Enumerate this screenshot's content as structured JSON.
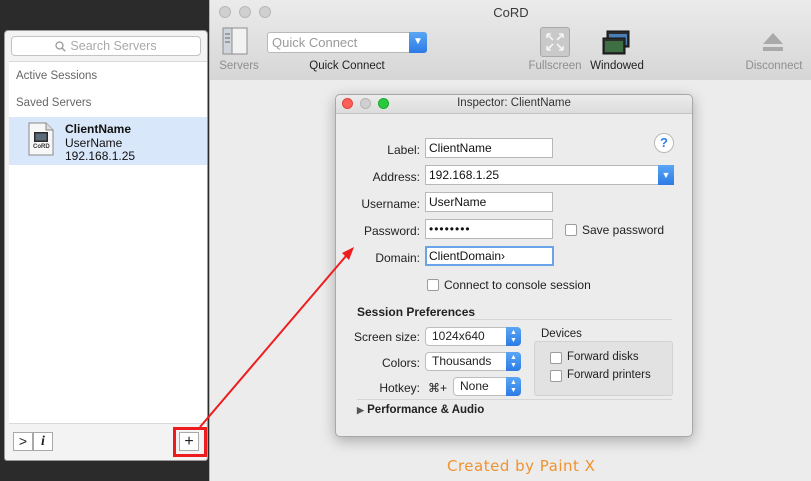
{
  "app": {
    "window_title": "CoRD"
  },
  "drawer": {
    "search_placeholder": "Search Servers",
    "active_sessions": "Active Sessions",
    "saved_servers": "Saved Servers",
    "server": {
      "name": "ClientName",
      "user": "UserName",
      "address": "192.168.1.25",
      "icon_text": "CoRD"
    },
    "expand_glyph": ">",
    "info_glyph": "i",
    "add_glyph": "+"
  },
  "toolbar": {
    "servers": "Servers",
    "quick_connect_placeholder": "Quick Connect",
    "quick_connect": "Quick Connect",
    "fullscreen": "Fullscreen",
    "windowed": "Windowed",
    "disconnect": "Disconnect"
  },
  "inspector": {
    "title": "Inspector: ClientName",
    "help": "?",
    "label_label": "Label:",
    "label_value": "ClientName",
    "address_label": "Address:",
    "address_value": "192.168.1.25",
    "username_label": "Username:",
    "username_value": "UserName",
    "password_label": "Password:",
    "password_value": "••••••••",
    "save_password": "Save password",
    "domain_label": "Domain:",
    "domain_value": "ClientDomain›",
    "console_session": "Connect to console session",
    "session_prefs": "Session Preferences",
    "screen_size_label": "Screen size:",
    "screen_size_value": "1024x640",
    "colors_label": "Colors:",
    "colors_value": "Thousands",
    "hotkey_label": "Hotkey:",
    "hotkey_modifier": "⌘+",
    "hotkey_value": "None",
    "devices": "Devices",
    "forward_disks": "Forward disks",
    "forward_printers": "Forward printers",
    "perf_audio": "Performance & Audio"
  },
  "watermark": "Created by Paint X",
  "colors": {
    "accent": "#2c7be5",
    "annotation": "#ee1c1c",
    "selection": "#d9e7fa",
    "watermark": "#f0922e"
  }
}
